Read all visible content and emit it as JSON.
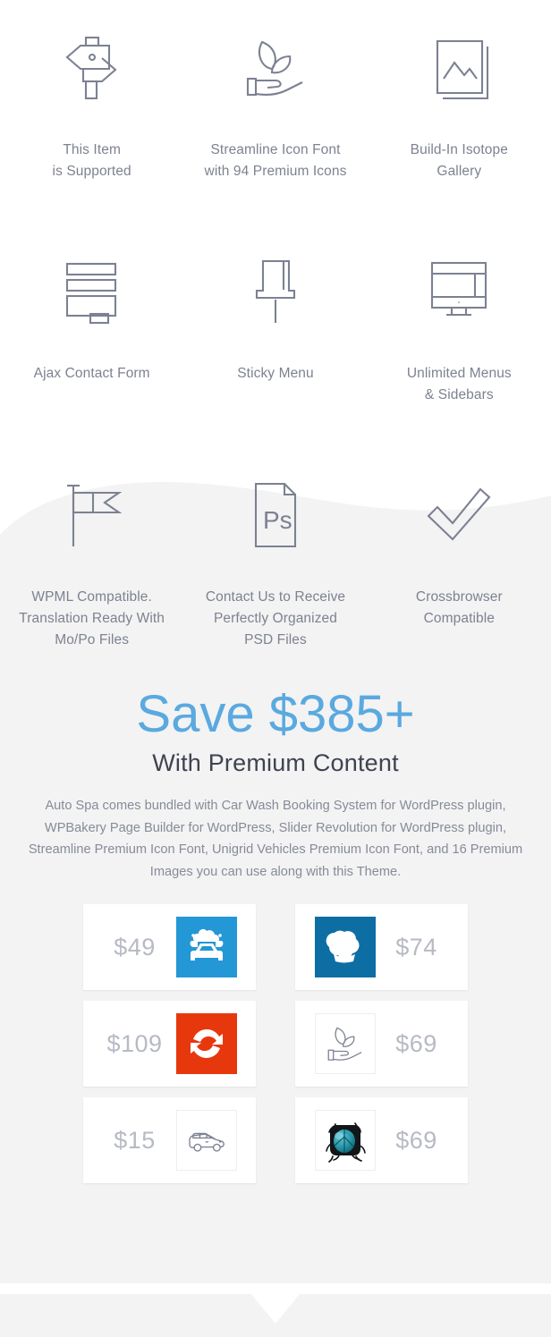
{
  "features": [
    {
      "id": "supported",
      "icon": "signpost-icon",
      "label": "This Item\nis Supported"
    },
    {
      "id": "icon-font",
      "icon": "hand-leaf-icon",
      "label": "Streamline Icon Font\nwith 94 Premium Icons"
    },
    {
      "id": "isotope",
      "icon": "image-stack-icon",
      "label": "Build-In Isotope\nGallery"
    },
    {
      "id": "contact-form",
      "icon": "contact-form-icon",
      "label": "Ajax Contact Form"
    },
    {
      "id": "sticky-menu",
      "icon": "pin-icon",
      "label": "Sticky Menu"
    },
    {
      "id": "menus-sidebars",
      "icon": "monitor-layout-icon",
      "label": "Unlimited Menus\n& Sidebars"
    },
    {
      "id": "wpml",
      "icon": "flag-icon",
      "label": "WPML Compatible.\nTranslation Ready With\nMo/Po Files"
    },
    {
      "id": "psd",
      "icon": "photoshop-file-icon",
      "label": "Contact Us to Receive\nPerfectly Organized\nPSD Files"
    },
    {
      "id": "crossbrowser",
      "icon": "checkmark-icon",
      "label": "Crossbrowser\nCompatible"
    }
  ],
  "promo": {
    "title": "Save $385+",
    "subtitle": "With Premium Content",
    "description": "Auto Spa comes bundled with Car Wash Booking System for WordPress plugin, WPBakery Page Builder for WordPress, Slider Revolution for WordPress plugin, Streamline Premium Icon Font, Unigrid Vehicles Premium Icon Font, and 16 Premium Images you can use along with this Theme."
  },
  "bundle_cards": [
    [
      {
        "id": "car-wash-booking",
        "price": "$49",
        "icon": "car-wash-icon",
        "layout": "price-left",
        "badge_bg": "#2497d6",
        "framed": false
      },
      {
        "id": "wpbakery",
        "price": "$74",
        "icon": "wpbakery-chefhat-icon",
        "layout": "price-right",
        "badge_bg": "#0d6ea4",
        "framed": false
      }
    ],
    [
      {
        "id": "slider-revolution",
        "price": "$109",
        "icon": "slider-revolution-icon",
        "layout": "price-left",
        "badge_bg": "#e7380d",
        "framed": false
      },
      {
        "id": "streamline-font",
        "price": "$69",
        "icon": "hand-leaf-icon",
        "layout": "price-right",
        "badge_bg": "#ffffff",
        "framed": true
      }
    ],
    [
      {
        "id": "unigrid-vehicles",
        "price": "$15",
        "icon": "suv-vehicle-icon",
        "layout": "price-left",
        "badge_bg": "#ffffff",
        "framed": true
      },
      {
        "id": "premium-images",
        "price": "$69",
        "icon": "beetle-bug-icon",
        "layout": "price-right",
        "badge_bg": "#ffffff",
        "framed": true
      }
    ]
  ],
  "colors": {
    "page_bg": "#ffffff",
    "section_bg": "#f3f3f3",
    "icon_stroke": "#7c8192",
    "feature_text": "#7d8290",
    "promo_accent": "#5aa9e0",
    "promo_sub": "#3f4350",
    "price_text": "#b6bac3"
  }
}
